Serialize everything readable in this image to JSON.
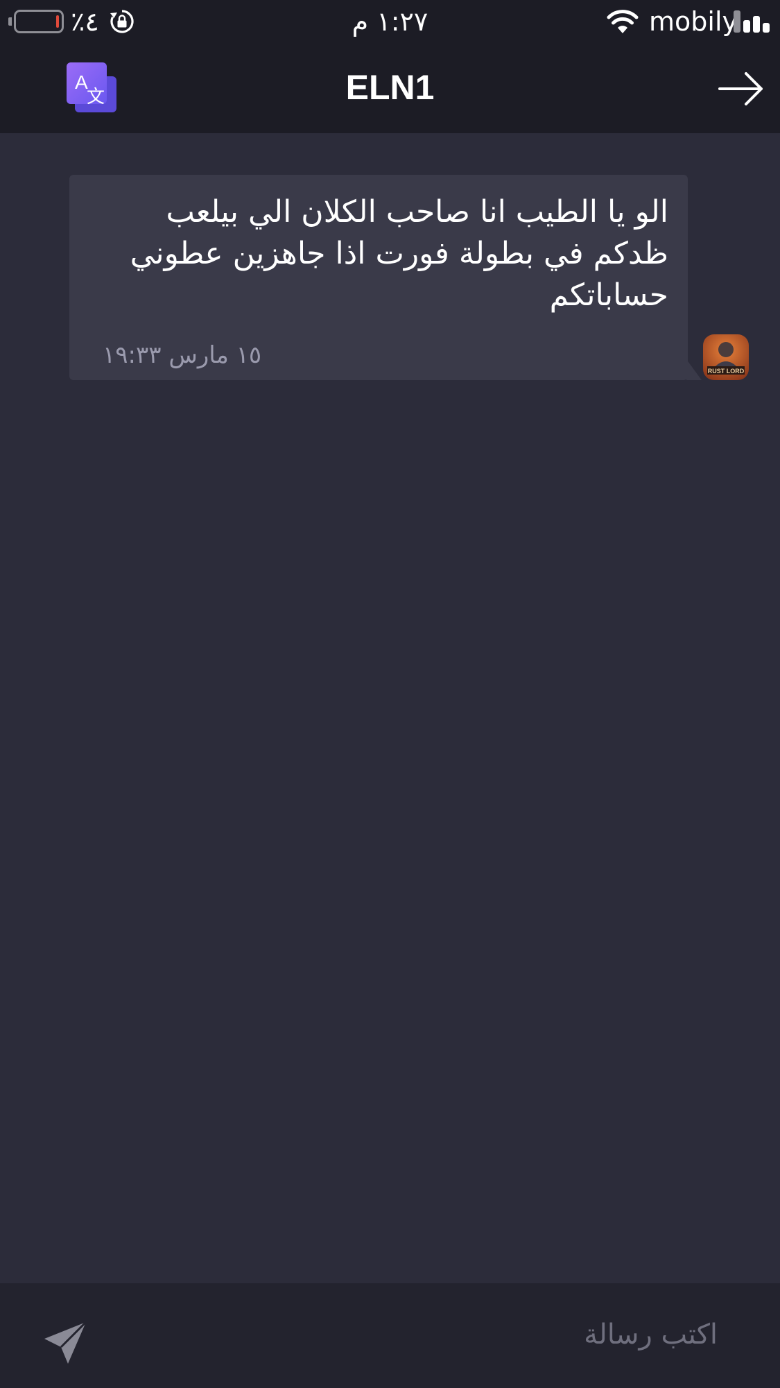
{
  "status_bar": {
    "battery_percent": "٪٤",
    "battery_level": 0.04,
    "time": "١:٢٧ م",
    "carrier": "mobily",
    "icons": [
      "battery-icon",
      "rotation-lock-icon",
      "wifi-icon",
      "signal-icon"
    ],
    "battery_color": "#e04a3b"
  },
  "header": {
    "title": "ELN1",
    "left_icon": "translate-icon",
    "right_icon": "back-arrow-icon"
  },
  "messages": [
    {
      "text": "الو يا الطيب انا صاحب الكلان الي بيلعب ظدكم في بطولة فورت اذا جاهزين عطوني حساباتكم",
      "time": "١٥ مارس ١٩:٣٣",
      "avatar_label": "RUST LORD"
    }
  ],
  "composer": {
    "placeholder": "اكتب رسالة",
    "send_icon": "send-icon"
  },
  "colors": {
    "background": "#2c2c3a",
    "bars": "#1c1c25",
    "bubble": "#3a3a49",
    "accent_translate": "#7b5cf0",
    "muted_text": "#9a9aad"
  }
}
